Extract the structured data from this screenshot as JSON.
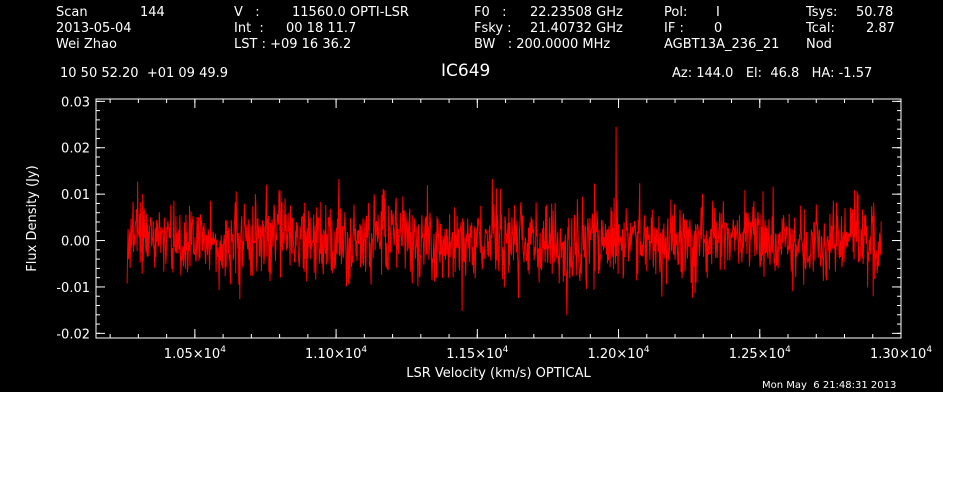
{
  "header": {
    "row1": {
      "scan_label": "Scan",
      "scan_value": "144",
      "v_label": "V   :",
      "v_value": "11560.0 OPTI-LSR",
      "f0_label": "F0   :",
      "f0_value": "22.23508 GHz",
      "pol_label": "Pol:",
      "pol_value": "I",
      "tsys_label": "Tsys:",
      "tsys_value": "50.78"
    },
    "row2": {
      "date": "2013-05-04",
      "int_label": "Int  :",
      "int_value": "00 18 11.7",
      "fsky_label": "Fsky :",
      "fsky_value": "21.40732 GHz",
      "if_label": "IF :",
      "if_value": "0",
      "tcal_label": "Tcal:",
      "tcal_value": "2.87"
    },
    "row3": {
      "observer": "Wei Zhao",
      "lst_label": "LST : +09 16 36.2",
      "bw_label": "BW   : 200.0000 MHz",
      "project": "AGBT13A_236_21",
      "mode": "Nod"
    },
    "coords": "10 50 52.20  +01 09 49.9",
    "source": "IC649",
    "az_el_ha": "Az: 144.0   El:  46.8   HA: -1.57"
  },
  "timestamp": "Mon May  6 21:48:31 2013",
  "colors": {
    "background": "#000000",
    "axes": "#ffffff",
    "trace": "#ff0000"
  },
  "chart_data": {
    "type": "line",
    "title": "IC649",
    "xlabel": "LSR Velocity (km/s) OPTICAL",
    "ylabel": "Flux Density (Jy)",
    "xlim": [
      10150,
      13000
    ],
    "ylim": [
      -0.021,
      0.0305
    ],
    "x_tick_labels": [
      {
        "value": 10500,
        "mantissa": "1.05",
        "exponent": "4"
      },
      {
        "value": 11000,
        "mantissa": "1.10",
        "exponent": "4"
      },
      {
        "value": 11500,
        "mantissa": "1.15",
        "exponent": "4"
      },
      {
        "value": 12000,
        "mantissa": "1.20",
        "exponent": "4"
      },
      {
        "value": 12500,
        "mantissa": "1.25",
        "exponent": "4"
      },
      {
        "value": 13000,
        "mantissa": "1.30",
        "exponent": "4"
      }
    ],
    "y_tick_labels": [
      {
        "value": 0.03,
        "label": "0.03"
      },
      {
        "value": 0.02,
        "label": "0.02"
      },
      {
        "value": 0.01,
        "label": "0.01"
      },
      {
        "value": 0.0,
        "label": "0.00"
      },
      {
        "value": -0.01,
        "label": "-0.01"
      },
      {
        "value": -0.02,
        "label": "-0.02"
      }
    ],
    "grid": false,
    "series": [
      {
        "color": "#ff0000",
        "x_start": 10260,
        "x_end": 12930,
        "n_channels": 1500,
        "noise_rms": 0.0047,
        "mean": 0.0,
        "min": -0.0175,
        "max": 0.0245,
        "peak_x": 11992
      }
    ]
  }
}
